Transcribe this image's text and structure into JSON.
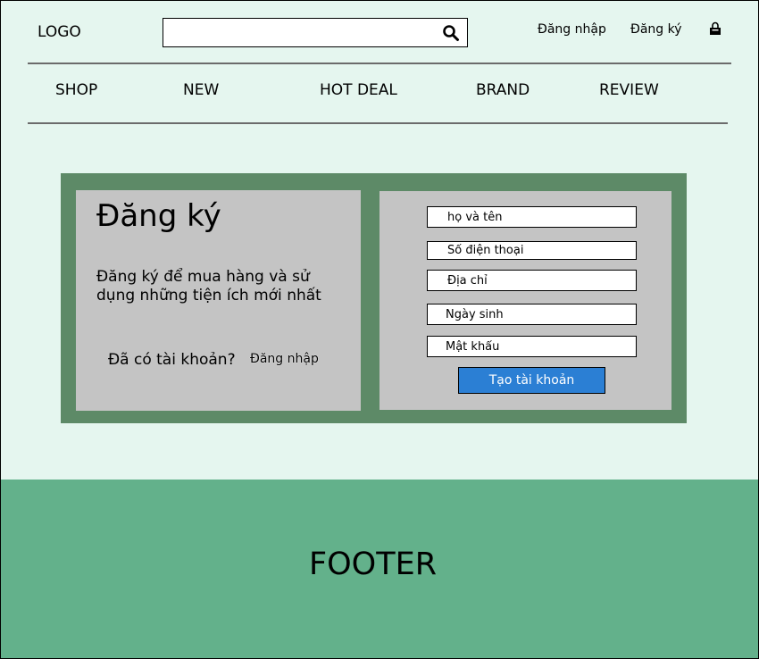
{
  "header": {
    "logo": "LOGO",
    "search": {
      "value": "",
      "placeholder": ""
    },
    "login_label": "Đăng nhập",
    "register_label": "Đăng ký",
    "icons": {
      "search": "search-icon",
      "cart": "shopping-bag-icon"
    }
  },
  "nav": {
    "items": [
      {
        "label": "SHOP"
      },
      {
        "label": "NEW"
      },
      {
        "label": "HOT DEAL"
      },
      {
        "label": "BRAND"
      },
      {
        "label": "REVIEW"
      }
    ]
  },
  "register": {
    "title": "Đăng ký",
    "description": "Đăng ký để mua hàng và sử dụng những tiện ích mới nhất",
    "have_account": "Đã có tài khoản?",
    "login_link": "Đăng nhập"
  },
  "form": {
    "fields": [
      {
        "placeholder": "họ và tên",
        "value": ""
      },
      {
        "placeholder": "Số điện thoại",
        "value": ""
      },
      {
        "placeholder": "Địa chỉ",
        "value": ""
      },
      {
        "placeholder": "Ngày sinh",
        "value": ""
      },
      {
        "placeholder": "Mật khẩu",
        "value": ""
      }
    ],
    "submit_label": "Tạo tài khoản"
  },
  "footer": {
    "text": "FOOTER"
  },
  "colors": {
    "background": "#e5f6ef",
    "panel": "#5d8a67",
    "card": "#c4c4c4",
    "button": "#2b7fd4",
    "footer": "#63b18b"
  }
}
